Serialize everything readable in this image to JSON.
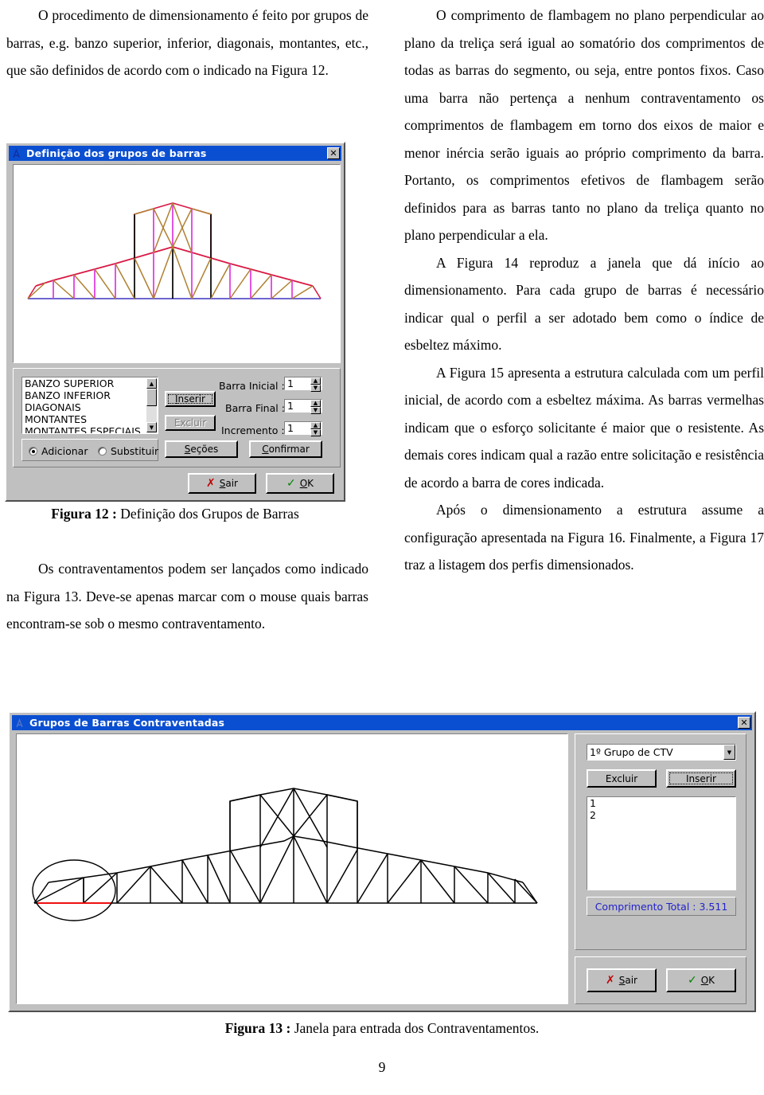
{
  "document": {
    "page_number": "9",
    "left_column": {
      "paragraphs": [
        "O procedimento de dimensionamento é feito por grupos de barras, e.g. banzo superior, inferior, diagonais, montantes, etc., que são definidos de acordo com o indicado na Figura 12."
      ],
      "paragraph_after_figure": "Os contraventamentos podem ser lançados como indicado na Figura 13. Deve-se apenas marcar com o mouse quais barras encontram-se sob o mesmo contraventamento."
    },
    "right_column": {
      "paragraphs": [
        "O comprimento de flambagem no plano perpendicular ao plano da treliça será igual ao somatório dos comprimentos de todas as barras do segmento, ou seja, entre pontos fixos. Caso uma barra não pertença a nenhum contraventamento os comprimentos de flambagem em torno dos eixos de maior e menor inércia serão iguais ao próprio comprimento da barra. Portanto, os comprimentos efetivos de flambagem serão definidos para as barras tanto no plano da treliça quanto no plano perpendicular a ela.",
        "A Figura 14 reproduz a janela que dá início ao dimensionamento. Para cada grupo de barras é necessário indicar qual o perfil a ser adotado bem como o índice de esbeltez máximo.",
        "A Figura 15 apresenta a estrutura calculada com um perfil inicial, de acordo com a esbeltez máxima. As barras vermelhas indicam que o esforço solicitante é maior que o resistente. As demais cores indicam qual a razão entre solicitação e resistência de acordo a barra de cores indicada.",
        "Após o dimensionamento a estrutura assume a configuração apresentada na Figura 16. Finalmente, a Figura 17 traz a listagem dos perfis dimensionados."
      ]
    }
  },
  "figure12": {
    "caption_label": "Figura 12 :",
    "caption_text": "Definição dos Grupos de Barras",
    "window": {
      "title": "Definição dos grupos de barras",
      "close_label": "✕",
      "group_list": {
        "items": [
          "BANZO SUPERIOR",
          "BANZO INFERIOR",
          "DIAGONAIS",
          "MONTANTES",
          "MONTANTES ESPECIAIS"
        ]
      },
      "buttons": {
        "inserir": "Inserir",
        "excluir": "Excluir",
        "secoes": "Seções",
        "confirmar": "Confirmar",
        "sair": "Sair",
        "ok": "OK"
      },
      "radios": {
        "adicionar": "Adicionar",
        "substituir": "Substituir",
        "selected": "adicionar"
      },
      "fields": [
        {
          "label": "Barra Inicial :",
          "value": "1"
        },
        {
          "label": "Barra Final :",
          "value": "1"
        },
        {
          "label": "Incremento :",
          "value": "1"
        }
      ]
    }
  },
  "figure13": {
    "caption_label": "Figura 13 :",
    "caption_text": "Janela para entrada dos Contraventamentos.",
    "window": {
      "title": "Grupos de Barras Contraventadas",
      "close_label": "✕",
      "combo": {
        "value": "1º Grupo de CTV"
      },
      "buttons": {
        "excluir": "Excluir",
        "inserir": "Inserir",
        "sair": "Sair",
        "ok": "OK"
      },
      "bar_list": {
        "items": [
          "1",
          "2"
        ]
      },
      "total_label": "Comprimento Total :",
      "total_value": "3.511"
    }
  },
  "colors": {
    "titlebar": "#0a4fd1",
    "dialog_face": "#c0c0c0",
    "top_chord": "#d81a45",
    "bottom_chord": "#5a50c8",
    "vertical": "#e040e0",
    "diagonal": "#b08030",
    "special_vertical": "#000000",
    "total_text": "#2222cc",
    "highlight_member": "#ff0000"
  }
}
